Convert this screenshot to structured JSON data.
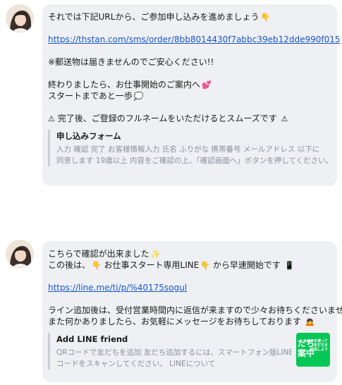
{
  "messages": [
    {
      "lines": [
        {
          "text": "それでは下記URLから、ご参加申し込みを進めましょう",
          "emoji": "👇"
        },
        {
          "text": ""
        },
        {
          "text": "https://thstan.com/sms/order/8bb8014430f7abbc39eb12dde990f015",
          "link": true
        },
        {
          "text": ""
        },
        {
          "text": "※郵送物は届きませんのでご安心ください!!"
        },
        {
          "text": ""
        },
        {
          "text": "終わりましたら、お仕事開始のご案内へ",
          "emoji": "💕"
        },
        {
          "text": "スタートまであと一歩",
          "emoji": "💭"
        },
        {
          "text": ""
        },
        {
          "prefix": "⚠",
          "text": " 完了後、ご登録のフルネームをいただけるとスムーズです ",
          "emoji": "⚠"
        }
      ],
      "preview": {
        "title": "申し込みフォーム",
        "desc_line1": "入力 確認 完了 お客様情報入力 氏名 ふりがな 携帯番号 メールアドレス 以下に",
        "desc_line2": "同意します 19歳以上 内容をご確認の上、「確認画面へ」ボタンを押してください。..."
      }
    },
    {
      "lines": [
        {
          "text": "こちらで確認が出来ました",
          "emoji": "✨"
        },
        {
          "text": "この後は、",
          "emoji": "👇",
          "text2": " お仕事スタート専用LINE",
          "emoji2": "👇",
          "text3": " から早速開始です ",
          "emoji3": "📱"
        },
        {
          "text": ""
        },
        {
          "text": "https://line.me/ti/p/%40175sogul",
          "link": true
        },
        {
          "text": ""
        },
        {
          "text": "ライン追加後は、受付営業時間内に返信が来ますので少々お待ちくださいませ",
          "emoji": "✨"
        },
        {
          "text": "また何かありましたら、お気軽にメッセージをお待ちしております ",
          "emoji": "🙇"
        }
      ],
      "preview": {
        "title": "Add LINE friend",
        "desc_line1": "QRコードで友だちを追加 友だち追加するには、スマートフォン版LINEでQR",
        "desc_line2": "コードをスキャンしてください。 LINEについて",
        "thumb_big": "だち\n案中",
        "thumb_small": "LINEを使って\n友だちを\n追加しよう"
      }
    }
  ],
  "icons": {
    "avatar": "avatar-icon",
    "pointing_down": "pointing-down-emoji",
    "sparkles": "sparkles-emoji",
    "hearts": "two-hearts-emoji",
    "warning": "warning-emoji",
    "phone": "mobile-phone-emoji",
    "bow": "bowing-person-emoji"
  },
  "colors": {
    "bubble": "#eef0f3",
    "link": "#1a56c9",
    "line_green": "#06c755",
    "preview_bar": "#c9ced6"
  }
}
